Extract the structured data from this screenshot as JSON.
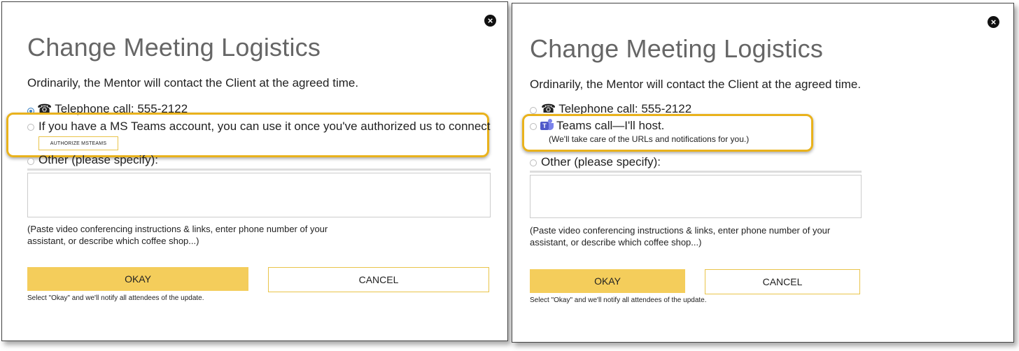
{
  "left": {
    "title": "Change Meeting Logistics",
    "intro": "Ordinarily, the Mentor will contact the Client at the agreed time.",
    "option_phone": "Telephone call: 555-2122",
    "option_teams": "If you have a MS Teams account, you can use it once you've authorized us to connect",
    "authorize_label": "AUTHORIZE MSTEAMS",
    "option_other": "Other (please specify):",
    "hint": "(Paste video conferencing instructions & links, enter phone number of your assistant, or describe which coffee shop...)",
    "okay_label": "OKAY",
    "cancel_label": "CANCEL",
    "note": "Select \"Okay\" and we'll notify all attendees of the update."
  },
  "right": {
    "title": "Change Meeting Logistics",
    "intro": "Ordinarily, the Mentor will contact the Client at the agreed time.",
    "option_phone": "Telephone call: 555-2122",
    "option_teams": "Teams call—I'll host.",
    "teams_sub": "(We'll take care of the URLs and notifications for you.)",
    "option_other": "Other (please specify):",
    "hint": "(Paste video conferencing instructions & links, enter phone number of your assistant, or describe which coffee shop...)",
    "okay_label": "OKAY",
    "cancel_label": "CANCEL",
    "note": "Select \"Okay\" and we'll notify all attendees of the update."
  },
  "icons": {
    "close": "close-icon",
    "phone": "telephone-icon",
    "teams": "ms-teams-icon"
  },
  "colors": {
    "accent": "#f4cd5b",
    "highlight": "#e9b21c",
    "selected_radio": "#3b82c4",
    "title": "#666666"
  }
}
